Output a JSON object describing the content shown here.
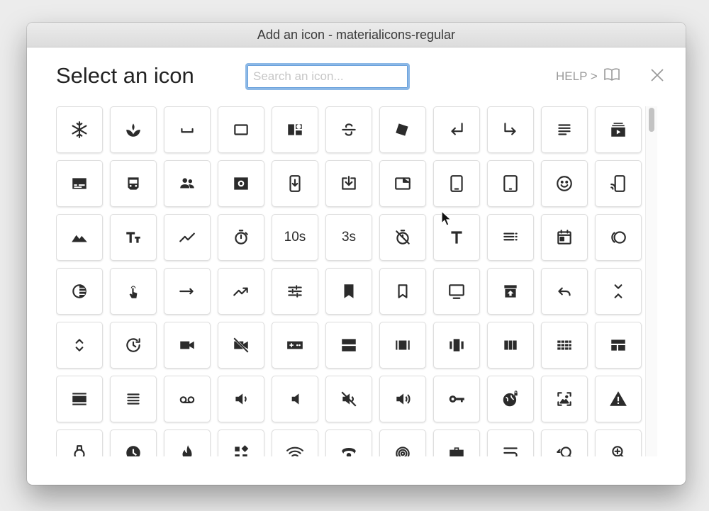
{
  "window": {
    "title": "Add an icon - materialicons-regular"
  },
  "dialog": {
    "title": "Select an icon"
  },
  "search": {
    "placeholder": "Search an icon...",
    "value": ""
  },
  "help": {
    "label": "HELP >"
  },
  "colors": {
    "icon": "#2b2b2b",
    "accent_focus": "#8cb8e6",
    "help_text": "#9a9a9a"
  },
  "icons": [
    "ac-unit-icon",
    "spa-icon",
    "space-bar-icon",
    "crop-landscape-icon",
    "auto-awesome-mosaic-icon",
    "strikethrough-icon",
    "style-icon",
    "subdirectory-arrow-left-icon",
    "subdirectory-arrow-right-icon",
    "subject-icon",
    "subscriptions-icon",
    "subtitles-icon",
    "subway-icon",
    "supervisor-account-icon",
    "surround-sound-icon",
    "stay-current-portrait-icon",
    "system-update-alt-icon",
    "tab-icon",
    "tablet-android-icon",
    "tablet-icon",
    "tag-faces-icon",
    "tap-and-play-icon",
    "terrain-icon",
    "text-fields-icon",
    "timeline-icon",
    "timer-icon",
    "timer-10-icon",
    "timer-3-icon",
    "timer-off-icon",
    "title-icon",
    "toc-icon",
    "today-icon",
    "tonality-icon",
    "tonality-half-icon",
    "touch-app-icon",
    "trending-flat-icon",
    "trending-up-icon",
    "tune-icon",
    "turned-in-icon",
    "turned-in-not-icon",
    "tv-icon",
    "unarchive-icon",
    "undo-icon",
    "unfold-less-icon",
    "unfold-more-icon",
    "update-icon",
    "videocam-icon",
    "videocam-off-icon",
    "videogame-asset-icon",
    "view-agenda-icon",
    "view-array-icon",
    "view-carousel-icon",
    "view-column-icon",
    "view-comfy-icon",
    "view-compact-icon",
    "view-day-icon",
    "view-headline-icon",
    "voicemail-icon",
    "volume-down-icon",
    "volume-mute-icon",
    "volume-off-icon",
    "volume-up-icon",
    "vpn-key-icon",
    "vpn-lock-icon",
    "wallpaper-icon",
    "warning-icon",
    "watch-icon",
    "watch-later-icon",
    "whatshot-icon",
    "widgets-icon",
    "wifi-icon",
    "wifi-tethering-icon",
    "wb-iridescent-icon",
    "work-icon",
    "wrap-text-icon",
    "youtube-searched-for-icon",
    "zoom-in-icon"
  ],
  "text_tiles": {
    "timer-10-icon": "10s",
    "timer-3-icon": "3s"
  }
}
